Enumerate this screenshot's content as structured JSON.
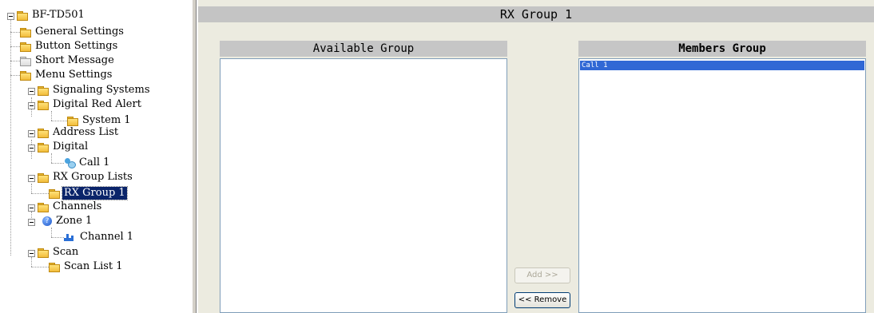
{
  "tree": {
    "root": "BF-TD501",
    "general_settings": "General Settings",
    "button_settings": "Button Settings",
    "short_message": "Short Message",
    "menu_settings": "Menu Settings",
    "signaling_systems": "Signaling Systems",
    "digital_red_alert": "Digital Red Alert",
    "system_1": "System 1",
    "address_list": "Address List",
    "digital": "Digital",
    "call_1": "Call 1",
    "rx_group_lists": "RX Group Lists",
    "rx_group_1": "RX Group 1",
    "channels": "Channels",
    "zone_1": "Zone 1",
    "channel_1": "Channel 1",
    "scan": "Scan",
    "scan_list_1": "Scan List 1"
  },
  "panel": {
    "title": "RX Group 1",
    "available_header": "Available Group",
    "members_header": "Members Group",
    "available_items": [],
    "members_items": [
      "Call 1"
    ],
    "add_label": "Add >>",
    "remove_label": "<< Remove"
  },
  "colors": {
    "selection": "#0a246a",
    "list_selection": "#3168d5",
    "panel_bg": "#ecebe0",
    "header_bg": "#c6c6c6"
  }
}
